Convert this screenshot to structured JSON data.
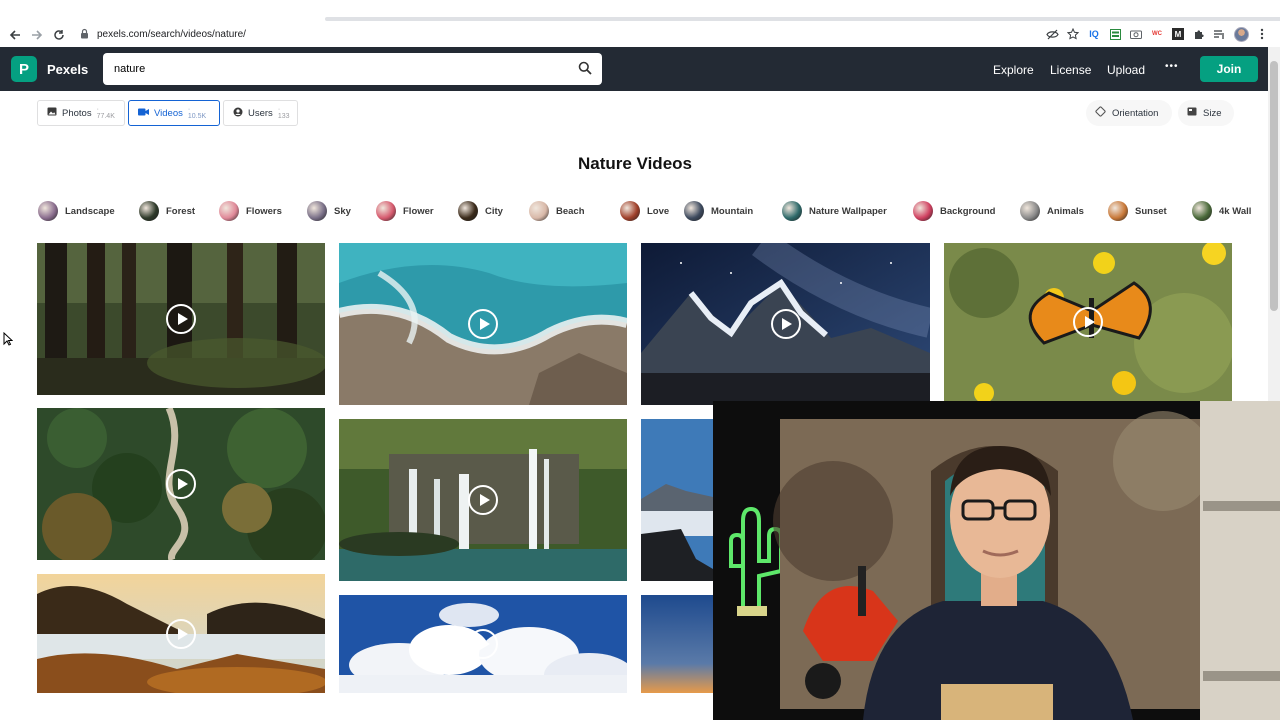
{
  "browser": {
    "url": "pexels.com/search/videos/nature/",
    "nav_icons": [
      "back-icon",
      "forward-icon",
      "reload-icon",
      "lock-icon"
    ],
    "extension_icons": [
      "eye-off-icon",
      "star-icon",
      "iq-icon",
      "sheet-icon",
      "camera-icon",
      "wc-icon",
      "m-icon",
      "puzzle-icon",
      "playlist-icon",
      "profile-avatar",
      "menu-icon"
    ],
    "ext_iq_label": "IQ",
    "ext_wc_label": "WC",
    "ext_m_label": "M"
  },
  "header": {
    "logo_letter": "P",
    "brand": "Pexels",
    "search_value": "nature",
    "nav": [
      "Explore",
      "License",
      "Upload"
    ],
    "more_glyph": "•••",
    "join_label": "Join"
  },
  "filters": {
    "tabs": [
      {
        "label": "Photos",
        "count": "77.4K"
      },
      {
        "label": "Videos",
        "count": "10.5K"
      },
      {
        "label": "Users",
        "count": "133"
      }
    ],
    "active_tab": "Videos",
    "orientation_label": "Orientation",
    "size_label": "Size"
  },
  "title": "Nature Videos",
  "chips": [
    {
      "label": "Landscape",
      "color": "#8a6d8e"
    },
    {
      "label": "Forest",
      "color": "#2e3a2a"
    },
    {
      "label": "Flowers",
      "color": "#e08898"
    },
    {
      "label": "Sky",
      "color": "#7a7088"
    },
    {
      "label": "Flower",
      "color": "#d65a6e"
    },
    {
      "label": "City",
      "color": "#3a2a1a"
    },
    {
      "label": "Beach",
      "color": "#d8b8a8"
    },
    {
      "label": "Love",
      "color": "#a0402a"
    },
    {
      "label": "Mountain",
      "color": "#3d4a5e"
    },
    {
      "label": "Nature Wallpaper",
      "color": "#2e6a6a"
    },
    {
      "label": "Background",
      "color": "#d04060"
    },
    {
      "label": "Animals",
      "color": "#8a8a8a"
    },
    {
      "label": "Sunset",
      "color": "#c87838"
    },
    {
      "label": "4k Wall",
      "color": "#4a6a3a"
    }
  ],
  "videos": [
    {
      "name": "forest-redwoods"
    },
    {
      "name": "ocean-aerial-coast"
    },
    {
      "name": "starry-mountain"
    },
    {
      "name": "butterfly-flowers"
    },
    {
      "name": "forest-road-aerial"
    },
    {
      "name": "waterfall-lake"
    },
    {
      "name": "mountain-clouds"
    },
    {
      "name": "sunset-rocky-shore"
    },
    {
      "name": "clouds-blue-sky"
    },
    {
      "name": "dusk-sky"
    }
  ],
  "webcam": {
    "description_label": "presenter-webcam"
  }
}
